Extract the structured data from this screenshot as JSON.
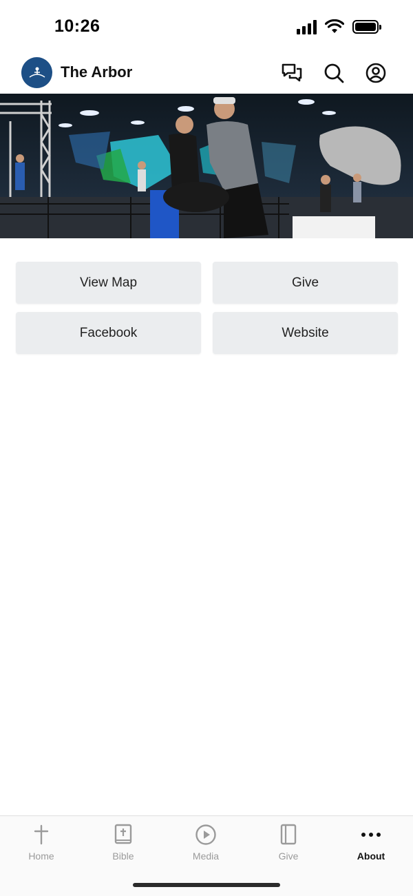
{
  "status_bar": {
    "time": "10:26"
  },
  "header": {
    "title": "The Arbor",
    "logo_icon": "church-logo-icon",
    "actions": [
      "chat-icon",
      "search-icon",
      "account-icon"
    ]
  },
  "hero": {
    "image": "trampoline-park-photo"
  },
  "buttons": [
    {
      "label": "View Map"
    },
    {
      "label": "Give"
    },
    {
      "label": "Facebook"
    },
    {
      "label": "Website"
    }
  ],
  "tabs": [
    {
      "label": "Home",
      "icon": "cross-icon",
      "active": false
    },
    {
      "label": "Bible",
      "icon": "bible-icon",
      "active": false
    },
    {
      "label": "Media",
      "icon": "play-icon",
      "active": false
    },
    {
      "label": "Give",
      "icon": "book-icon",
      "active": false
    },
    {
      "label": "About",
      "icon": "more-icon",
      "active": true
    }
  ],
  "colors": {
    "brand": "#1d4f86",
    "button_bg": "#ebedef",
    "tab_inactive": "#9a9a9a",
    "tab_active": "#111111"
  }
}
